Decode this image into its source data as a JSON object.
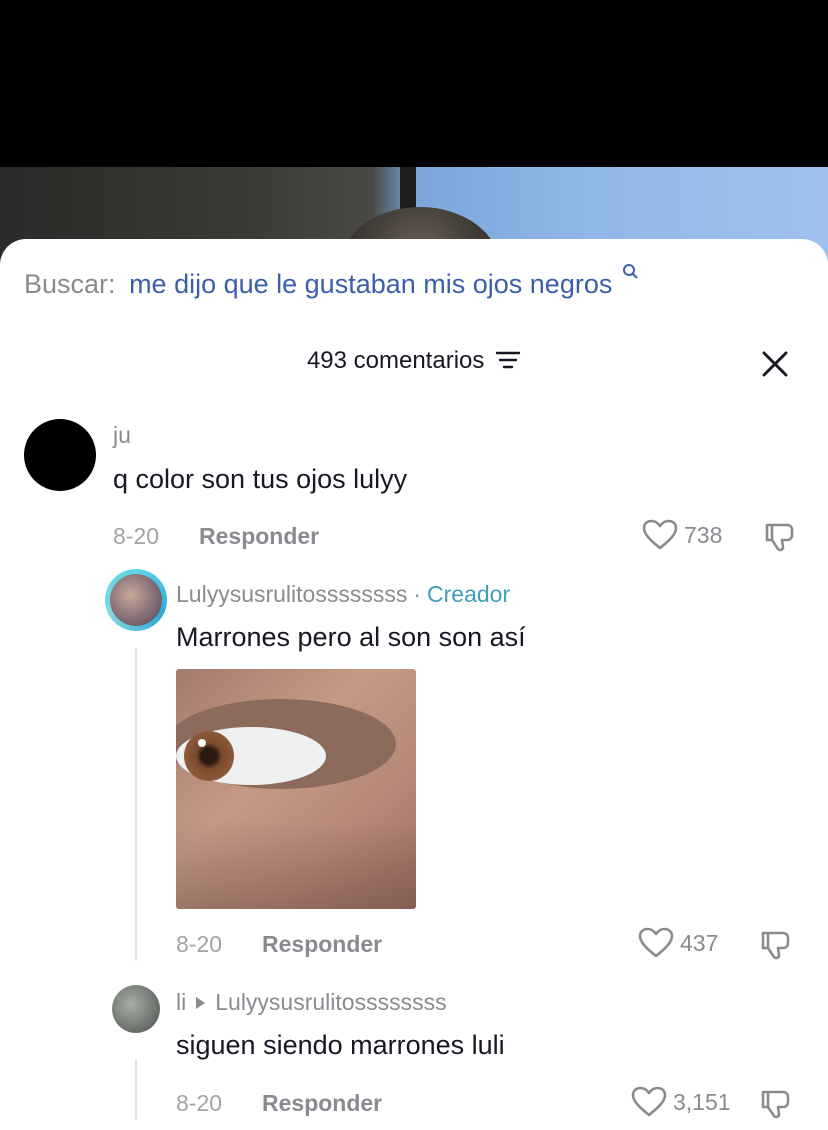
{
  "search": {
    "label": "Buscar:",
    "query": "me dijo que le gustaban mis ojos negros"
  },
  "header": {
    "count_label": "493 comentarios"
  },
  "comments": [
    {
      "username": "ju",
      "text": "q color son tus ojos lulyy",
      "date": "8-20",
      "reply_label": "Responder",
      "likes": "738"
    },
    {
      "username": "Lulyysusrulitossssssss",
      "badge": "Creador",
      "separator": "·",
      "text": "Marrones pero al son son así",
      "date": "8-20",
      "reply_label": "Responder",
      "likes": "437"
    },
    {
      "username": "li",
      "reply_to": "Lulyysusrulitossssssss",
      "text": "siguen siendo marrones luli",
      "date": "8-20",
      "reply_label": "Responder",
      "likes": "3,151"
    }
  ],
  "colors": {
    "accent_link": "#3b5fa8",
    "creator": "#3e9fb8",
    "text": "#161823",
    "muted": "#8a8b91"
  }
}
